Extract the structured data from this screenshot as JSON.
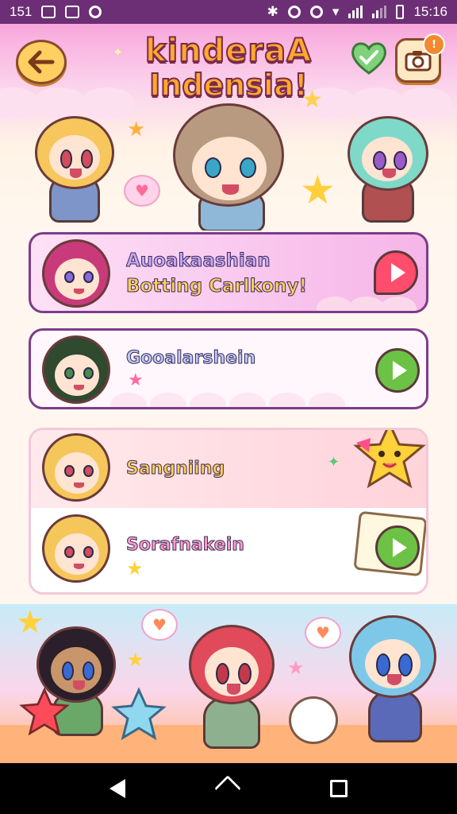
{
  "status_bar": {
    "notification_count": "151",
    "time": "15:16",
    "icons": [
      "gallery-icon",
      "mail-icon",
      "settings-icon",
      "bluetooth-icon",
      "nfc-icon",
      "alarm-icon",
      "wifi-icon",
      "signal-icon",
      "signal-icon",
      "battery-icon"
    ]
  },
  "header": {
    "title_line1": "kinderaA",
    "title_line2": "Indensia!",
    "back_icon": "arrow-left-icon",
    "camera_icon": "camera-icon",
    "heart_icon": "heart-check-icon",
    "camera_badge": "!"
  },
  "cards": [
    {
      "label_line1": "Auoakaashian",
      "label_line2": "Botting Carlkony!",
      "button_icon": "play-icon"
    },
    {
      "label": "Gooalarshein",
      "button_icon": "play-icon"
    },
    {
      "label": "Sangniing"
    },
    {
      "label": "Sorafnakein",
      "button_icon": "play-icon"
    }
  ],
  "colors": {
    "status_bar": "#6c2f75",
    "card_border": "#7d3c8a",
    "accent_yellow": "#ffcf62",
    "play_red": "#ff4d6d",
    "play_green": "#6cc244"
  }
}
